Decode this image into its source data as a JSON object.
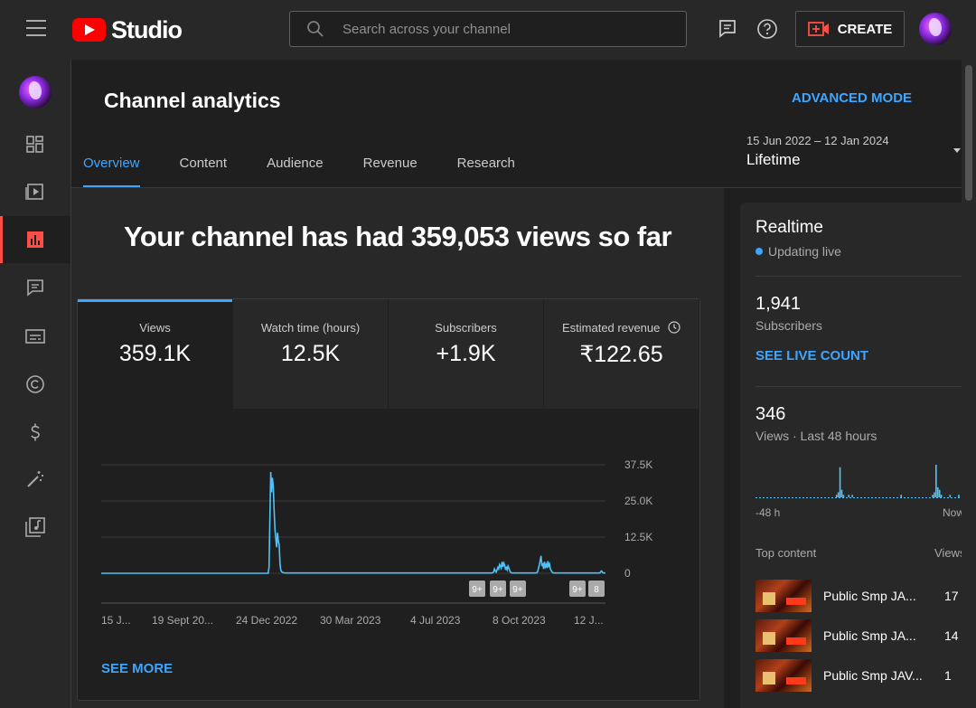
{
  "topbar": {
    "brand": "Studio",
    "search_placeholder": "Search across your channel",
    "create_label": "CREATE"
  },
  "page": {
    "title": "Channel analytics",
    "advanced_mode": "ADVANCED MODE",
    "date_range": "15 Jun 2022 – 12 Jan 2024",
    "date_label": "Lifetime"
  },
  "tabs": [
    {
      "label": "Overview",
      "active": true
    },
    {
      "label": "Content"
    },
    {
      "label": "Audience"
    },
    {
      "label": "Revenue"
    },
    {
      "label": "Research"
    }
  ],
  "headline": "Your channel has had 359,053 views so far",
  "metrics": [
    {
      "label": "Views",
      "value": "359.1K"
    },
    {
      "label": "Watch time (hours)",
      "value": "12.5K"
    },
    {
      "label": "Subscribers",
      "value": "+1.9K"
    },
    {
      "label": "Estimated revenue",
      "value": "₹122.65"
    }
  ],
  "chart_data": {
    "type": "line",
    "series": [
      {
        "values": [
          0,
          0,
          0,
          0,
          0,
          0,
          0,
          0,
          0,
          0,
          0,
          0,
          0,
          0,
          0,
          0,
          0,
          0,
          0,
          0,
          0,
          0,
          0,
          0,
          0,
          0,
          0,
          0,
          0,
          0,
          0,
          0,
          0,
          0,
          0,
          0,
          0,
          0,
          0,
          0,
          0,
          0,
          0,
          0,
          0,
          0,
          0,
          0,
          0,
          0,
          0,
          0,
          0,
          0,
          0,
          0,
          0,
          0,
          0,
          0,
          0,
          0,
          0,
          0,
          0,
          0,
          0,
          0,
          0,
          0,
          0,
          0,
          0,
          0,
          0,
          0,
          0,
          0,
          0,
          0,
          0,
          0,
          0,
          0,
          0,
          0,
          0,
          0,
          0,
          0,
          0,
          0,
          0,
          0,
          0,
          0,
          0,
          0,
          0,
          0,
          0,
          0,
          0,
          0,
          0,
          0,
          0,
          0,
          0,
          0,
          0,
          0,
          0,
          0,
          0,
          0,
          0,
          0,
          0,
          0,
          0,
          0,
          0,
          0,
          0,
          0,
          0,
          0,
          0,
          0,
          0,
          0,
          0,
          0,
          0,
          0,
          0,
          0,
          0,
          0,
          0,
          0,
          0,
          0,
          0,
          0,
          0,
          0,
          0,
          0,
          0,
          0,
          0,
          0,
          0,
          0,
          0,
          0,
          0,
          0,
          0,
          0,
          0,
          0,
          0,
          0,
          0,
          0,
          0,
          0,
          0,
          0,
          0,
          0,
          0,
          0,
          0,
          0,
          0,
          0,
          0,
          0,
          0,
          0,
          0,
          0,
          0,
          0,
          0,
          0,
          0,
          0,
          0,
          0,
          0,
          0,
          0,
          0,
          2000,
          18000,
          35000,
          28000,
          33000,
          30000,
          22000,
          15000,
          12000,
          9000,
          14000,
          11000,
          10000,
          3000,
          1000,
          500,
          300,
          200,
          150,
          100,
          100,
          100,
          100,
          100,
          100,
          100,
          100,
          100,
          100,
          100,
          100,
          100,
          100,
          100,
          100,
          100,
          100,
          100,
          100,
          100,
          100,
          100,
          100,
          100,
          100,
          100,
          100,
          100,
          100,
          100,
          100,
          100,
          100,
          100,
          100,
          100,
          100,
          100,
          100,
          100,
          100,
          100,
          100,
          100,
          100,
          100,
          100,
          100,
          100,
          100,
          100,
          100,
          100,
          100,
          100,
          100,
          100,
          100,
          100,
          100,
          100,
          100,
          100,
          100,
          100,
          100,
          100,
          100,
          100,
          100,
          100,
          100,
          100,
          100,
          100,
          100,
          100,
          100,
          100,
          100,
          100,
          100,
          100,
          100,
          100,
          100,
          100,
          100,
          100,
          100,
          100,
          100,
          100,
          100,
          100,
          100,
          100,
          100,
          100,
          100,
          100,
          100,
          100,
          100,
          100,
          100,
          100,
          100,
          100,
          100,
          100,
          100,
          100,
          100,
          100,
          100,
          100,
          100,
          100,
          100,
          100,
          100,
          100,
          100,
          100,
          100,
          100,
          100,
          100,
          100,
          100,
          100,
          100,
          100,
          100,
          100,
          100,
          100,
          100,
          100,
          100,
          100,
          100,
          100,
          100,
          100,
          100,
          100,
          100,
          100,
          100,
          100,
          100,
          100,
          100,
          100,
          100,
          100,
          100,
          100,
          100,
          100,
          100,
          100,
          100,
          100,
          100,
          100,
          100,
          100,
          100,
          100,
          100,
          100,
          100,
          100,
          100,
          100,
          100,
          100,
          100,
          100,
          100,
          100,
          100,
          100,
          100,
          100,
          100,
          100,
          100,
          100,
          100,
          100,
          100,
          100,
          100,
          100,
          100,
          100,
          100,
          100,
          100,
          100,
          100,
          100,
          100,
          100,
          100,
          100,
          100,
          100,
          100,
          100,
          100,
          100,
          100,
          100,
          100,
          100,
          100,
          100,
          100,
          100,
          100,
          100,
          100,
          100,
          100,
          100,
          100,
          100,
          100,
          100,
          100,
          100,
          100,
          100,
          100,
          100,
          100,
          100,
          100,
          100,
          200,
          500,
          1500,
          800,
          400,
          1200,
          2000,
          1500,
          3000,
          2500,
          1800,
          4000,
          2200,
          3500,
          2800,
          1500,
          2000,
          1200,
          2500,
          1800,
          900,
          300,
          200,
          100,
          100,
          100,
          100,
          100,
          100,
          100,
          100,
          100,
          100,
          100,
          100,
          100,
          100,
          100,
          100,
          100,
          100,
          100,
          100,
          100,
          100,
          100,
          100,
          100,
          100,
          100,
          100,
          100,
          200,
          600,
          1800,
          3000,
          4500,
          6000,
          2500,
          3500,
          1500,
          4000,
          2200,
          3000,
          1800,
          4200,
          2500,
          3200,
          1500,
          900,
          400,
          200,
          100,
          100,
          100,
          100,
          100,
          100,
          100,
          100,
          100,
          100,
          100,
          100,
          100,
          100,
          100,
          100,
          100,
          100,
          100,
          100,
          100,
          100,
          100,
          100,
          100,
          100,
          100,
          100,
          100,
          100,
          100,
          100,
          100,
          100,
          100,
          100,
          100,
          100,
          100,
          100,
          100,
          100,
          100,
          100,
          100,
          100,
          100,
          100,
          100,
          100,
          100,
          100,
          100,
          100,
          100,
          300,
          800,
          600,
          200,
          100,
          100,
          100
        ]
      }
    ],
    "yticks": [
      "37.5K",
      "25.0K",
      "12.5K",
      "0"
    ],
    "yvalues": [
      37500,
      25000,
      12500,
      0
    ],
    "ylim": [
      0,
      37500
    ],
    "xlabels": [
      "15 J...",
      "19 Sept 20...",
      "24 Dec 2022",
      "30 Mar 2023",
      "4 Jul 2023",
      "8 Oct 2023",
      "12 J..."
    ],
    "badges": [
      "9+",
      "9+",
      "9+",
      "9+",
      "8"
    ]
  },
  "see_more": "SEE MORE",
  "realtime": {
    "title": "Realtime",
    "status": "Updating live",
    "subscribers_value": "1,941",
    "subscribers_label": "Subscribers",
    "live_count": "SEE LIVE COUNT",
    "views_value": "346",
    "views_label": "Views · Last 48 hours",
    "axis_left": "-48 h",
    "axis_right": "Now",
    "spark": [
      0,
      0,
      0,
      0,
      0,
      0,
      0,
      0,
      0,
      0,
      0,
      0,
      0,
      0,
      0,
      0,
      0,
      0,
      0,
      0,
      0,
      0,
      0,
      0,
      0,
      0,
      0,
      0,
      0,
      0,
      0,
      0,
      0,
      0,
      0,
      0,
      0,
      0,
      0,
      0,
      0,
      0,
      0,
      0,
      0,
      0,
      1,
      2,
      12,
      3,
      1,
      0,
      0,
      1,
      0,
      1,
      0,
      0,
      0,
      0,
      0,
      0,
      0,
      0,
      0,
      0,
      0,
      0,
      0,
      0,
      0,
      0,
      0,
      0,
      0,
      0,
      0,
      0,
      0,
      0,
      0,
      0,
      0,
      1,
      0,
      0,
      0,
      0,
      0,
      0,
      0,
      0,
      0,
      0,
      0,
      0,
      0,
      0,
      0,
      0,
      0,
      1,
      2,
      13,
      4,
      3,
      1,
      0,
      0,
      0,
      0,
      1,
      0,
      0,
      0,
      0,
      1,
      0
    ],
    "top_content_label": "Top content",
    "top_content_views": "Views",
    "top_content": [
      {
        "title": "Public Smp JA...",
        "count": "17"
      },
      {
        "title": "Public Smp JA...",
        "count": "14"
      },
      {
        "title": "Public Smp JAV...",
        "count": "1"
      }
    ]
  }
}
